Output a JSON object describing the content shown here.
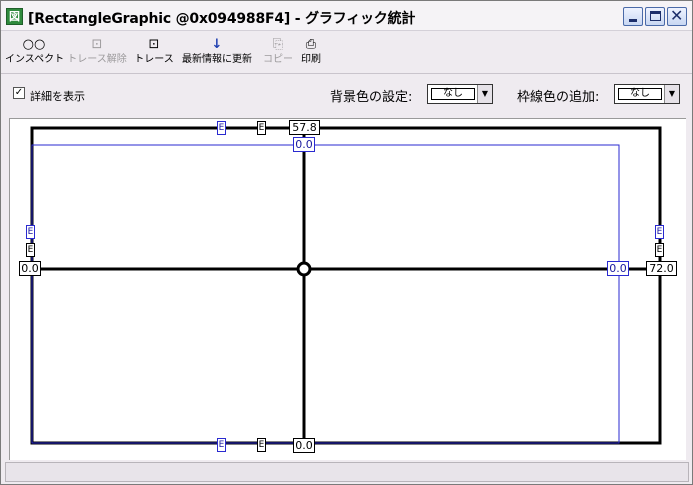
{
  "window": {
    "title": "[RectangleGraphic @0x094988F4] - グラフィック統計",
    "app_icon": "graphic-stats-app-icon",
    "app_icon_glyph": "図"
  },
  "controls": {
    "minimize": "minimize-icon",
    "maximize": "maximize-icon",
    "close": "close-icon"
  },
  "toolbar": {
    "items": [
      {
        "label": "インスペクト",
        "icon": "glasses-icon",
        "glyph": "○○",
        "enabled": true
      },
      {
        "label": "トレース解除",
        "icon": "untrace-icon",
        "glyph": "⊡",
        "enabled": false
      },
      {
        "label": "トレース",
        "icon": "trace-icon",
        "glyph": "⊡",
        "enabled": true
      },
      {
        "label": "最新情報に更新",
        "icon": "refresh-icon",
        "glyph": "↓",
        "enabled": true
      },
      {
        "label": "コピー",
        "icon": "copy-icon",
        "glyph": "⎘",
        "enabled": false
      },
      {
        "label": "印刷",
        "icon": "print-icon",
        "glyph": "⎙",
        "enabled": true
      }
    ]
  },
  "options": {
    "show_details_label": "詳細を表示",
    "show_details_checked": true,
    "background_color_label": "背景色の設定:",
    "background_color_value": "なし",
    "border_color_label": "枠線色の追加:",
    "border_color_value": "なし"
  },
  "graphic": {
    "top_value": "57.8",
    "bottom_value": "0.0",
    "left_value": "0.0",
    "right_value": "72.0",
    "inner_top_value": "0.0",
    "inner_right_value": "0.0",
    "marker_letter": "E",
    "outer_color": "#000000",
    "inner_color": "#2a2ad0"
  }
}
